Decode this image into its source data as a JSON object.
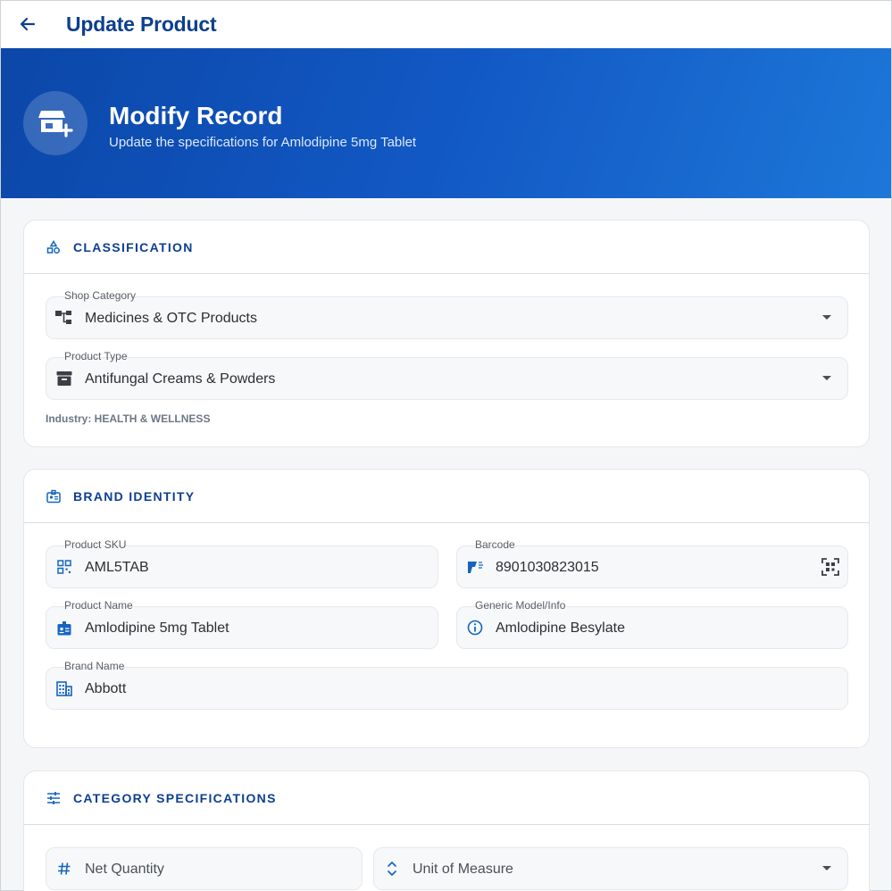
{
  "appbar": {
    "title": "Update Product"
  },
  "hero": {
    "title": "Modify Record",
    "subtitle": "Update the specifications for Amlodipine 5mg Tablet"
  },
  "classification": {
    "title": "CLASSIFICATION",
    "shop_category": {
      "label": "Shop Category",
      "value": "Medicines & OTC Products"
    },
    "product_type": {
      "label": "Product Type",
      "value": "Antifungal Creams & Powders"
    },
    "industry": "Industry: HEALTH & WELLNESS"
  },
  "brand_identity": {
    "title": "BRAND IDENTITY",
    "sku": {
      "label": "Product SKU",
      "value": "AML5TAB"
    },
    "barcode": {
      "label": "Barcode",
      "value": "8901030823015"
    },
    "product_name": {
      "label": "Product Name",
      "value": "Amlodipine 5mg Tablet"
    },
    "generic_model": {
      "label": "Generic Model/Info",
      "value": "Amlodipine Besylate"
    },
    "brand_name": {
      "label": "Brand Name",
      "value": "Abbott"
    }
  },
  "category_specs": {
    "title": "CATEGORY SPECIFICATIONS",
    "net_quantity": {
      "placeholder": "Net Quantity"
    },
    "unit_of_measure": {
      "placeholder": "Unit of Measure"
    }
  },
  "colors": {
    "accent": "#0d3f8f",
    "hero_start": "#0b47a8",
    "hero_end": "#1d77d8",
    "icon_blue": "#1565c0"
  },
  "icons": {
    "back": "arrow-left-icon",
    "hero": "store-add-icon",
    "classification": "shapes-icon",
    "brand": "badge-id-icon",
    "specs": "sliders-icon",
    "shop_category": "category-tree-icon",
    "product_type": "archive-box-icon",
    "sku": "qr-code-icon",
    "barcode": "barcode-scanner-icon",
    "barcode_scan": "qr-scan-icon",
    "product_name": "id-badge-icon",
    "generic_model": "info-icon",
    "brand_name": "building-icon",
    "net_quantity": "hash-icon",
    "unit": "unfold-icon"
  }
}
